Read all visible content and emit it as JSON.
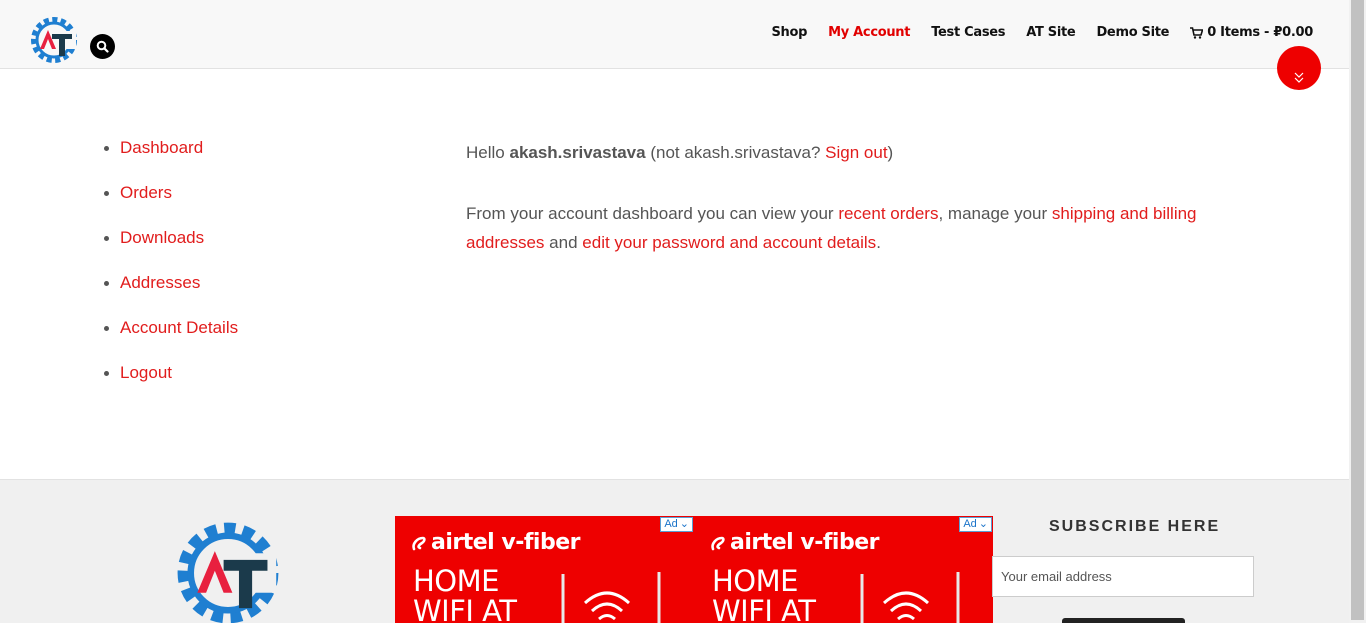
{
  "header": {
    "nav": [
      {
        "label": "Shop",
        "active": false
      },
      {
        "label": "My Account",
        "active": true
      },
      {
        "label": "Test Cases",
        "active": false
      },
      {
        "label": "AT Site",
        "active": false
      },
      {
        "label": "Demo Site",
        "active": false
      }
    ],
    "cart_label": "0 Items - ₽0.00"
  },
  "account_nav": [
    "Dashboard",
    "Orders",
    "Downloads",
    "Addresses",
    "Account Details",
    "Logout"
  ],
  "content": {
    "hello": "Hello",
    "username": "akash.srivastava",
    "not_prefix": "(not akash.srivastava?",
    "sign_out": "Sign out",
    "not_suffix": ")",
    "intro": "From your account dashboard you can view your",
    "recent_orders": "recent orders",
    "manage": ", manage your",
    "addresses_link": "shipping and billing addresses",
    "and": "and",
    "edit_link": "edit your password and account details",
    "period": "."
  },
  "footer": {
    "ads": [
      {
        "brand": "airtel v-fiber",
        "headline_1": "HOME",
        "headline_2": "WIFI AT",
        "badge": "Ad"
      },
      {
        "brand": "airtel v-fiber",
        "headline_1": "HOME",
        "headline_2": "WIFI AT",
        "badge": "Ad"
      }
    ],
    "subscribe_title": "SUBSCRIBE HERE",
    "email_placeholder": "Your email address"
  },
  "colors": {
    "accent": "#e11d1d",
    "ad_red": "#ee0000",
    "logo_blue": "#1f7fd1",
    "logo_red": "#e8203f",
    "logo_dark": "#1b3a4b"
  }
}
